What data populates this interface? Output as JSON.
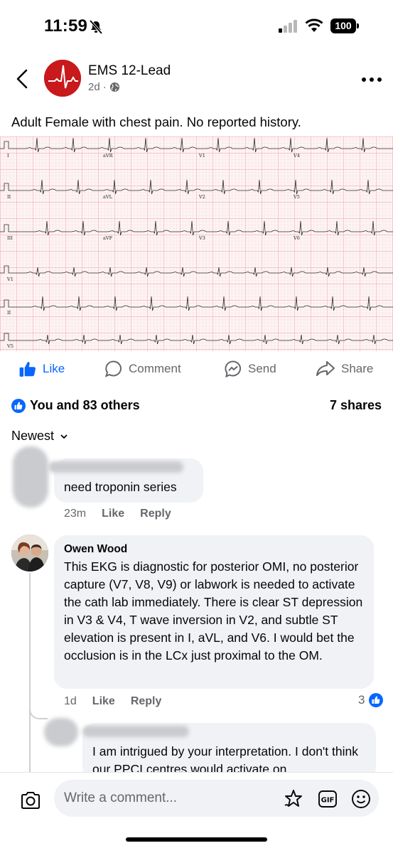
{
  "status_bar": {
    "time": "11:59",
    "battery": "100",
    "icons": [
      "bell-slash-icon",
      "signal-icon",
      "wifi-icon",
      "battery-icon"
    ]
  },
  "post": {
    "page_name": "EMS 12-Lead",
    "time": "2d",
    "separator": "·",
    "caption": "Adult Female with chest pain. No reported history.",
    "ekg_lead_labels": [
      "I",
      "aVR",
      "V1",
      "V4",
      "II",
      "aVL",
      "V2",
      "V5",
      "III",
      "aVF",
      "V3",
      "V6",
      "V1",
      "II",
      "V5"
    ]
  },
  "actions": {
    "like": "Like",
    "comment": "Comment",
    "send": "Send",
    "share": "Share"
  },
  "reactions": {
    "summary": "You and 83 others",
    "shares": "7 shares"
  },
  "sort": {
    "label": "Newest"
  },
  "comments": [
    {
      "name": "",
      "text": "need troponin series",
      "time": "23m",
      "like": "Like",
      "reply": "Reply"
    },
    {
      "name": "Owen Wood",
      "text": "This EKG is diagnostic for posterior OMI, no posterior capture (V7, V8, V9) or labwork is needed to activate the cath lab immediately. There is clear ST depression in V3 & V4, T wave inversion in V2, and subtle ST elevation is present in I, aVL, and V6. I would bet the occlusion is in the LCx just proximal to the OM.",
      "time": "1d",
      "like": "Like",
      "reply": "Reply",
      "reaction_count": "3"
    },
    {
      "name": "",
      "text": "I am intrigued by your interpretation. I don't think our PPCI centres would activate on"
    }
  ],
  "composer": {
    "placeholder": "Write a comment...",
    "icons": [
      "camera-icon",
      "sticker-icon",
      "gif-icon",
      "emoji-icon"
    ]
  },
  "colors": {
    "facebook_blue": "#0866ff",
    "secondary_text": "#65676b",
    "bubble_bg": "#f0f2f5",
    "ekg_grid": "#f4b8c0",
    "page_avatar_red": "#c8191c"
  }
}
